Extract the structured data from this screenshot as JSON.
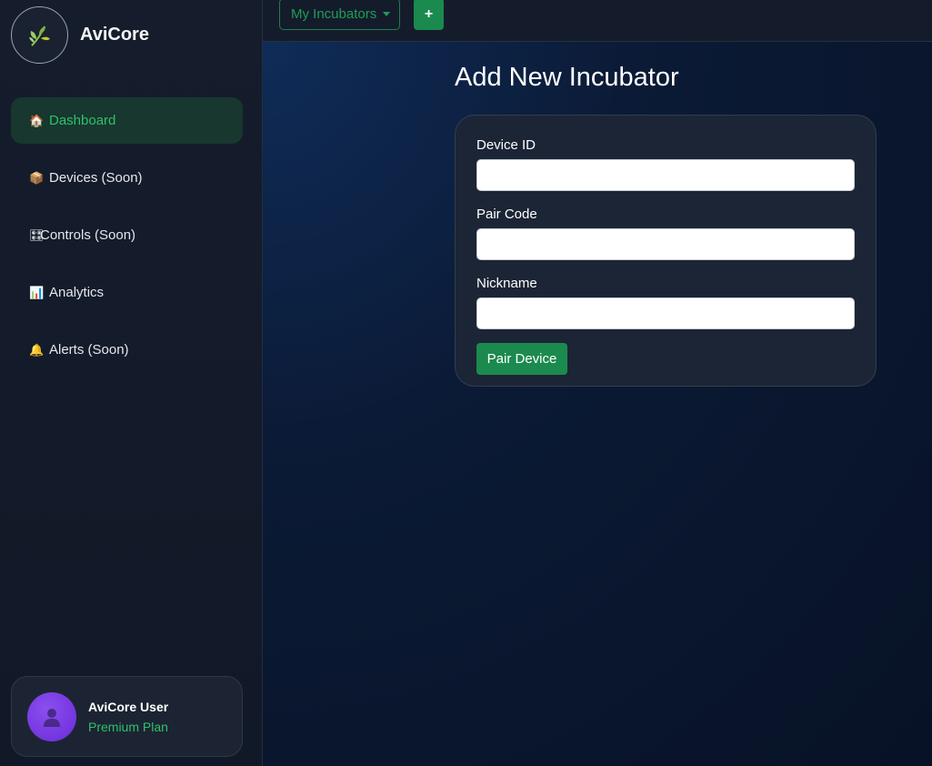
{
  "brand": {
    "name": "AviCore",
    "logo_icon": "leaf-icon"
  },
  "sidebar": {
    "items": [
      {
        "emoji": "🏠",
        "label": "Dashboard",
        "active": true,
        "icon": "house-icon"
      },
      {
        "emoji": "📦",
        "label": "Devices (Soon)",
        "active": false,
        "icon": "package-icon"
      },
      {
        "emoji": "🎛",
        "label": "Controls (Soon)",
        "active": false,
        "icon": "control-knobs-icon"
      },
      {
        "emoji": "📊",
        "label": "Analytics",
        "active": false,
        "icon": "bar-chart-icon"
      },
      {
        "emoji": "🔔",
        "label": "Alerts (Soon)",
        "active": false,
        "icon": "bell-icon"
      }
    ],
    "user": {
      "name": "AviCore User",
      "plan": "Premium Plan",
      "avatar_icon": "user-silhouette-icon"
    }
  },
  "topbar": {
    "dropdown_label": "My Incubators",
    "add_label": "+"
  },
  "main": {
    "title": "Add New Incubator",
    "form": {
      "fields": [
        {
          "label": "Device ID",
          "value": "",
          "placeholder": ""
        },
        {
          "label": "Pair Code",
          "value": "",
          "placeholder": ""
        },
        {
          "label": "Nickname",
          "value": "",
          "placeholder": ""
        }
      ],
      "submit_label": "Pair Device"
    }
  },
  "colors": {
    "accent_green": "#1b8a4e",
    "active_text_green": "#2fc06a",
    "sidebar_bg": "#151d2d",
    "card_bg": "#1c2535",
    "avatar_purple": "#7c3aed"
  }
}
